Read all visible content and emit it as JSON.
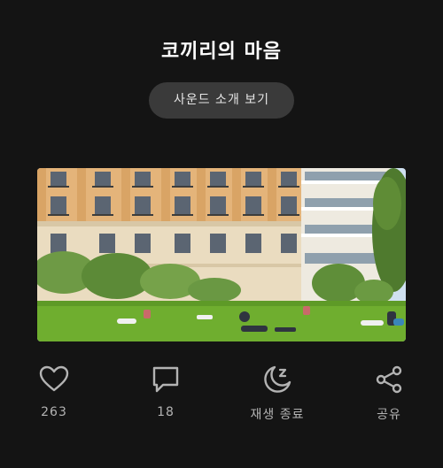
{
  "header": {
    "title": "코끼리의 마음"
  },
  "intro_button": {
    "label": "사운드 소개 보기"
  },
  "actions": {
    "like": {
      "icon": "heart-icon",
      "label": "263"
    },
    "comment": {
      "icon": "comment-bubble-icon",
      "label": "18"
    },
    "sleep_timer": {
      "icon": "moon-sleep-icon",
      "label": "재생 종료"
    },
    "share": {
      "icon": "share-icon",
      "label": "공유"
    }
  },
  "colors": {
    "background": "#141414",
    "button_bg": "#3a3a3a",
    "icon": "#b3b3b3",
    "label": "#b3b3b3"
  }
}
